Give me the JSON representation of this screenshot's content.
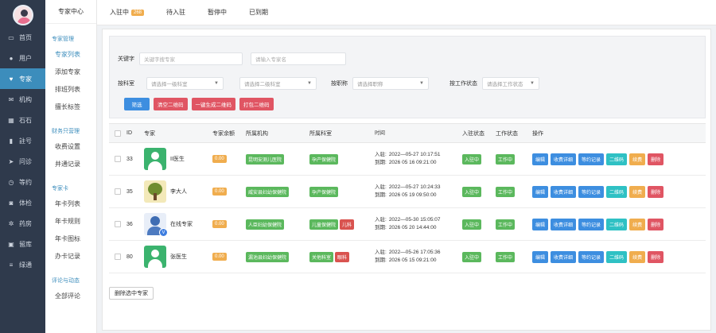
{
  "nav": {
    "items": [
      {
        "label": "首页",
        "icon": "monitor-icon"
      },
      {
        "label": "用户",
        "icon": "user-icon"
      },
      {
        "label": "专家",
        "icon": "heart-icon"
      },
      {
        "label": "机构",
        "icon": "mail-icon"
      },
      {
        "label": "石石",
        "icon": "grid-icon"
      },
      {
        "label": "註号",
        "icon": "chart-icon"
      },
      {
        "label": "问诊",
        "icon": "plane-icon"
      },
      {
        "label": "等约",
        "icon": "history-icon"
      },
      {
        "label": "体检",
        "icon": "camera-icon"
      },
      {
        "label": "药房",
        "icon": "gear-icon"
      },
      {
        "label": "留库",
        "icon": "lock-icon"
      },
      {
        "label": "绿通",
        "icon": "list-icon"
      }
    ]
  },
  "menu": {
    "title": "专家中心",
    "groups": [
      {
        "title": "专家管理",
        "items": [
          "专家列表",
          "添加专家",
          "排班列表",
          "擅长标签"
        ]
      },
      {
        "title": "财务只营理",
        "items": [
          "收费设置",
          "并通记录"
        ]
      },
      {
        "title": "专家卡",
        "items": [
          "年卡列表",
          "年卡规则",
          "年卡图标",
          "办卡记录"
        ]
      },
      {
        "title": "评论与动态",
        "items": [
          "全部评论"
        ]
      }
    ]
  },
  "tabs": [
    {
      "label": "入驻中",
      "count": "268"
    },
    {
      "label": "待入驻",
      "count": ""
    },
    {
      "label": "暂停中",
      "count": ""
    },
    {
      "label": "已到期",
      "count": ""
    }
  ],
  "filters": {
    "keyword_label": "关键字",
    "keyword_placeholder": "关键字搜专家",
    "name_placeholder": "请输入专家名",
    "dept_label": "按科室",
    "dept1_placeholder": "请选择一级科室",
    "dept2_placeholder": "请选择二级科室",
    "title_label": "按职称",
    "title_placeholder": "请选择职称",
    "status_label": "按工作状态",
    "status_placeholder": "请选择工作状态",
    "buttons": [
      "筛选",
      "清空二维码",
      "一键生成二维码",
      "打包二维码"
    ]
  },
  "table": {
    "headers": [
      "ID",
      "专家",
      "专家余额",
      "所属机构",
      "所属科室",
      "时间",
      "入驻状态",
      "工作状态",
      "操作"
    ],
    "time_in_label": "入驻:",
    "time_out_label": "到期:",
    "rows": [
      {
        "id": "33",
        "name": "II医生",
        "avatar": "doctor",
        "balance": "0.00",
        "org": "昆明安测儿医院",
        "depts": [
          {
            "t": "孕产保健院",
            "c": "green"
          }
        ],
        "in": "2022—05-27 10:17:51",
        "out": "2026 05 16 09:21:00",
        "s1": "入驻中",
        "s2": "工作中"
      },
      {
        "id": "35",
        "name": "李大人",
        "avatar": "tree",
        "balance": "0.00",
        "org": "威安县妇幼保健院",
        "depts": [
          {
            "t": "孕产保健院",
            "c": "green"
          }
        ],
        "in": "2022—05-27 10:24:33",
        "out": "2026 05 19 09:50:00",
        "s1": "入驻中",
        "s2": "工作中"
      },
      {
        "id": "36",
        "name": "在线专家",
        "avatar": "online",
        "balance": "0.00",
        "org": "人臣妇幼保健院",
        "depts": [
          {
            "t": "儿童保健院",
            "c": "green"
          },
          {
            "t": "儿科",
            "c": "red"
          }
        ],
        "in": "2022—05-30 15:05:07",
        "out": "2026 05 20 14:44:00",
        "s1": "入驻中",
        "s2": "工作中"
      },
      {
        "id": "80",
        "name": "张医生",
        "avatar": "doctor",
        "balance": "0.00",
        "org": "漏池县妇幼保健院",
        "depts": [
          {
            "t": "关他科室",
            "c": "green"
          },
          {
            "t": "眼科",
            "c": "red"
          }
        ],
        "in": "2022—05-26 17:05:36",
        "out": "2026 05 15 09:21:00",
        "s1": "入驻中",
        "s2": "工作中"
      }
    ],
    "ops": [
      {
        "label": "编辑",
        "c": "blue"
      },
      {
        "label": "收费详细",
        "c": "blue"
      },
      {
        "label": "等约记录",
        "c": "blue"
      },
      {
        "label": "二维码",
        "c": "teal"
      },
      {
        "label": "续费",
        "c": "orange"
      },
      {
        "label": "删除",
        "c": "red"
      }
    ]
  },
  "batch_delete": "删除选中专家"
}
